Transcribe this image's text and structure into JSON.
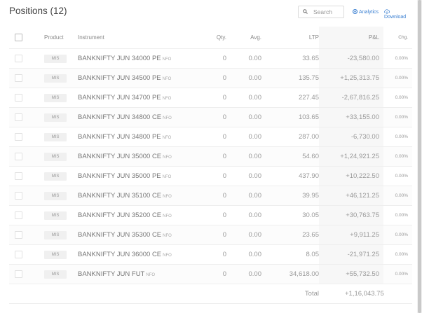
{
  "header": {
    "title": "Positions (12)",
    "search_placeholder": "Search",
    "analytics_label": "Analytics",
    "download_label": "Download"
  },
  "table": {
    "columns": [
      "Product",
      "Instrument",
      "Qty.",
      "Avg.",
      "LTP",
      "P&L",
      "Chg."
    ],
    "rows": [
      {
        "product": "MIS",
        "instrument": "BANKNIFTY JUN 34000 PE",
        "exchange": "NFO",
        "qty": "0",
        "avg": "0.00",
        "ltp": "33.65",
        "pnl": "-23,580.00",
        "chg": "0.00%"
      },
      {
        "product": "MIS",
        "instrument": "BANKNIFTY JUN 34500 PE",
        "exchange": "NFO",
        "qty": "0",
        "avg": "0.00",
        "ltp": "135.75",
        "pnl": "+1,25,313.75",
        "chg": "0.00%"
      },
      {
        "product": "MIS",
        "instrument": "BANKNIFTY JUN 34700 PE",
        "exchange": "NFO",
        "qty": "0",
        "avg": "0.00",
        "ltp": "227.45",
        "pnl": "-2,67,816.25",
        "chg": "0.00%"
      },
      {
        "product": "MIS",
        "instrument": "BANKNIFTY JUN 34800 CE",
        "exchange": "NFO",
        "qty": "0",
        "avg": "0.00",
        "ltp": "103.65",
        "pnl": "+33,155.00",
        "chg": "0.00%"
      },
      {
        "product": "MIS",
        "instrument": "BANKNIFTY JUN 34800 PE",
        "exchange": "NFO",
        "qty": "0",
        "avg": "0.00",
        "ltp": "287.00",
        "pnl": "-6,730.00",
        "chg": "0.00%"
      },
      {
        "product": "MIS",
        "instrument": "BANKNIFTY JUN 35000 CE",
        "exchange": "NFO",
        "qty": "0",
        "avg": "0.00",
        "ltp": "54.60",
        "pnl": "+1,24,921.25",
        "chg": "0.00%"
      },
      {
        "product": "MIS",
        "instrument": "BANKNIFTY JUN 35000 PE",
        "exchange": "NFO",
        "qty": "0",
        "avg": "0.00",
        "ltp": "437.90",
        "pnl": "+10,222.50",
        "chg": "0.00%"
      },
      {
        "product": "MIS",
        "instrument": "BANKNIFTY JUN 35100 CE",
        "exchange": "NFO",
        "qty": "0",
        "avg": "0.00",
        "ltp": "39.95",
        "pnl": "+46,121.25",
        "chg": "0.00%"
      },
      {
        "product": "MIS",
        "instrument": "BANKNIFTY JUN 35200 CE",
        "exchange": "NFO",
        "qty": "0",
        "avg": "0.00",
        "ltp": "30.05",
        "pnl": "+30,763.75",
        "chg": "0.00%"
      },
      {
        "product": "MIS",
        "instrument": "BANKNIFTY JUN 35300 CE",
        "exchange": "NFO",
        "qty": "0",
        "avg": "0.00",
        "ltp": "23.65",
        "pnl": "+9,911.25",
        "chg": "0.00%"
      },
      {
        "product": "MIS",
        "instrument": "BANKNIFTY JUN 36000 CE",
        "exchange": "NFO",
        "qty": "0",
        "avg": "0.00",
        "ltp": "8.05",
        "pnl": "-21,971.25",
        "chg": "0.00%"
      },
      {
        "product": "MIS",
        "instrument": "BANKNIFTY JUN FUT",
        "exchange": "NFO",
        "qty": "0",
        "avg": "0.00",
        "ltp": "34,618.00",
        "pnl": "+55,732.50",
        "chg": "0.00%"
      }
    ],
    "total_label": "Total",
    "total_pnl": "+1,16,043.75"
  },
  "colors": {
    "accent": "#387ed1",
    "profit": "#4caf50",
    "pnl_column_bg": "#f7f7f7"
  },
  "icons": {
    "search": "search-icon",
    "analytics": "analytics-icon",
    "download": "download-icon",
    "select_all": "checkbox-icon"
  }
}
